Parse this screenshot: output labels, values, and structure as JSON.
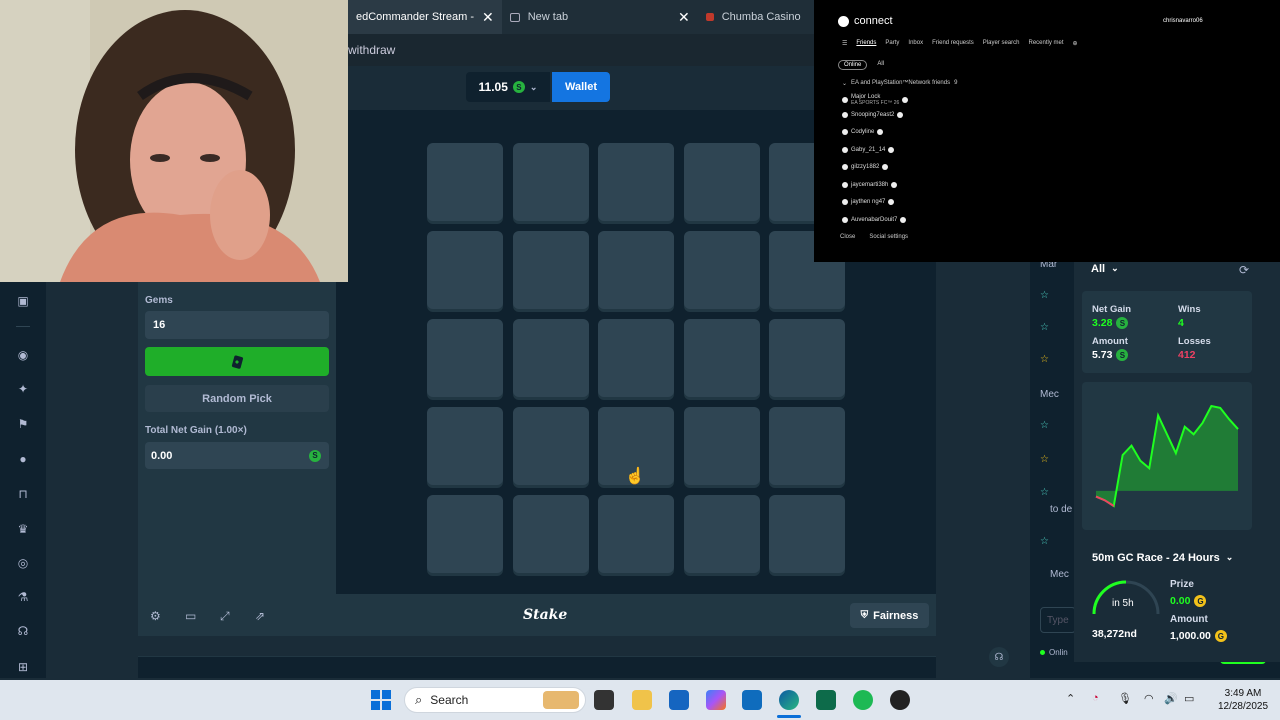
{
  "browser": {
    "tabs": [
      {
        "label": "edCommander Stream -",
        "close": "✕"
      },
      {
        "label": "New tab",
        "close": "✕"
      },
      {
        "label": "Chumba Casino",
        "close": ""
      }
    ],
    "address_fragment": "withdraw"
  },
  "header": {
    "balance": "11.05",
    "currency_icon": "S",
    "wallet_label": "Wallet"
  },
  "controls": {
    "gems_label": "Gems",
    "gems_value": "16",
    "bet_icon": "gem-card-icon",
    "random_pick_label": "Random Pick",
    "net_gain_label": "Total Net Gain (1.00×)",
    "net_gain_value": "0.00"
  },
  "grid": {
    "rows": 5,
    "cols": 5
  },
  "footer": {
    "logo": "Stake",
    "fairness_label": "Fairness"
  },
  "chat": {
    "rows": [
      "Mar",
      "Mec",
      "to de",
      "Mec"
    ],
    "input_placeholder": "Type",
    "online_label": "Onlin"
  },
  "live_stats": {
    "filter": "All",
    "net_gain_label": "Net Gain",
    "net_gain_value": "3.28",
    "wins_label": "Wins",
    "wins_value": "4",
    "amount_label": "Amount",
    "amount_value": "5.73",
    "losses_label": "Losses",
    "losses_value": "412",
    "colors": {
      "profit": "#1fff20",
      "loss": "#ed4163"
    },
    "chart_series": [
      -0.3,
      -0.5,
      -0.8,
      1.9,
      2.4,
      1.6,
      1.2,
      4.0,
      3.0,
      2.0,
      3.4,
      3.0,
      3.6,
      4.5,
      4.4,
      3.8,
      3.28
    ]
  },
  "race": {
    "title": "50m GC Race - 24 Hours",
    "time_left": "in 5h",
    "rank": "38,272nd",
    "prize_label": "Prize",
    "prize_value": "0.00",
    "amount_label": "Amount",
    "amount_value": "1,000.00",
    "progress": 0.5
  },
  "ea": {
    "brand": "connect",
    "user": "chrisnavarro06",
    "tabs": [
      "Friends",
      "Party",
      "Inbox",
      "Friend requests",
      "Player search",
      "Recently met"
    ],
    "filters": [
      "Online",
      "All"
    ],
    "group_label": "EA and PlayStation™Network friends",
    "group_count": "9",
    "friends": [
      {
        "name": "Major Lock",
        "status": "EA SPORTS FC™ 26"
      },
      {
        "name": "Snooping7east2",
        "status": ""
      },
      {
        "name": "Codyline",
        "status": ""
      },
      {
        "name": "Gaby_21_14",
        "status": ""
      },
      {
        "name": "gilzzy1882",
        "status": ""
      },
      {
        "name": "jaycemarti38h",
        "status": ""
      },
      {
        "name": "jaythen ng47",
        "status": ""
      },
      {
        "name": "AuvenabarDouit7",
        "status": ""
      }
    ],
    "close_label": "Close",
    "settings_label": "Social settings"
  },
  "taskbar": {
    "search_label": "Search",
    "time": "3:49 AM",
    "date": "12/28/2025"
  }
}
